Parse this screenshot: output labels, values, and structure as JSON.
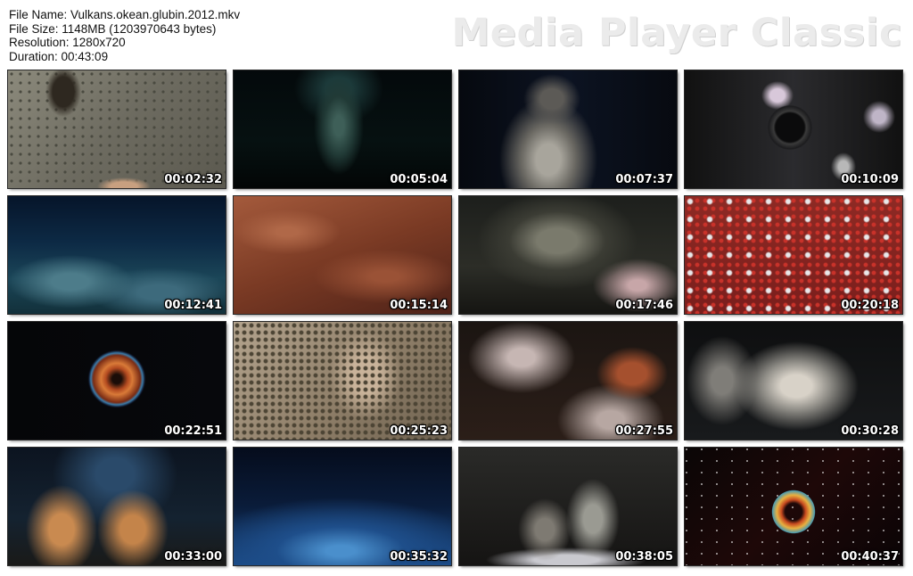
{
  "file_info": {
    "file_name": "File Name: Vulkans.okean.glubin.2012.mkv",
    "file_size": "File Size: 1148MB (1203970643 bytes)",
    "resolution": "Resolution: 1280x720",
    "duration": "Duration: 00:43:09"
  },
  "brand": "Media Player Classic",
  "thumbnails": [
    {
      "timestamp": "00:02:32"
    },
    {
      "timestamp": "00:05:04"
    },
    {
      "timestamp": "00:07:37"
    },
    {
      "timestamp": "00:10:09"
    },
    {
      "timestamp": "00:12:41"
    },
    {
      "timestamp": "00:15:14"
    },
    {
      "timestamp": "00:17:46"
    },
    {
      "timestamp": "00:20:18"
    },
    {
      "timestamp": "00:22:51"
    },
    {
      "timestamp": "00:25:23"
    },
    {
      "timestamp": "00:27:55"
    },
    {
      "timestamp": "00:30:28"
    },
    {
      "timestamp": "00:33:00"
    },
    {
      "timestamp": "00:35:32"
    },
    {
      "timestamp": "00:38:05"
    },
    {
      "timestamp": "00:40:37"
    }
  ]
}
